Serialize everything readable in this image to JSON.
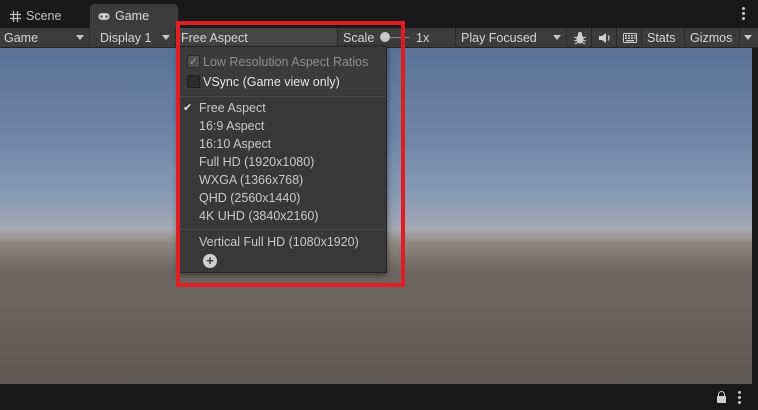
{
  "tabs": [
    {
      "label": "Scene",
      "icon": "grid-icon",
      "active": false
    },
    {
      "label": "Game",
      "icon": "gamepad-icon",
      "active": true
    }
  ],
  "toolbar": {
    "view_mode": "Game",
    "display": "Display 1",
    "aspect": "Free Aspect",
    "scale_label": "Scale",
    "scale_value": "1x",
    "play_mode": "Play Focused",
    "stats_label": "Stats",
    "gizmos_label": "Gizmos"
  },
  "dropdown": {
    "low_res_label": "Low Resolution Aspect Ratios",
    "low_res_checked": true,
    "vsync_label": "VSync (Game view only)",
    "vsync_checked": false,
    "selected": "Free Aspect",
    "items": [
      "Free Aspect",
      "16:9 Aspect",
      "16:10 Aspect",
      "Full HD (1920x1080)",
      "WXGA (1366x768)",
      "QHD (2560x1440)",
      "4K UHD (3840x2160)"
    ],
    "custom_items": [
      "Vertical Full HD (1080x1920)"
    ],
    "check_glyph": "✓",
    "tick_glyph": "✔",
    "add_glyph": "+"
  },
  "colors": {
    "highlight": "#e11d24",
    "toolbar_bg": "#3c3c3c",
    "menu_bg": "#383838"
  }
}
